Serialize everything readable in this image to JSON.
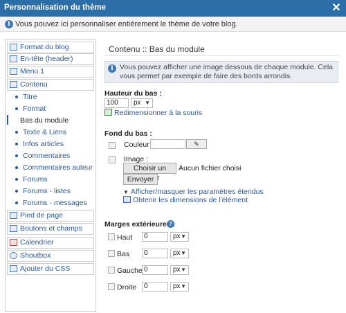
{
  "window": {
    "title": "Personnalisation du thème",
    "close_label": "✕"
  },
  "infobar": {
    "text": "Vous pouvez ici personnaliser entièrement le thème de votre blog."
  },
  "sidebar": {
    "items": [
      {
        "label": "Format du blog"
      },
      {
        "label": "En-tête (header)"
      },
      {
        "label": "Menu 1"
      },
      {
        "label": "Contenu"
      },
      {
        "label": "Pied de page"
      },
      {
        "label": "Boutons et champs"
      },
      {
        "label": "Calendrier"
      },
      {
        "label": "Shoutbox"
      },
      {
        "label": "Ajouter du CSS"
      }
    ],
    "subitems": [
      {
        "label": "Titre"
      },
      {
        "label": "Format"
      },
      {
        "label": "Bas du module"
      },
      {
        "label": "Texte & Liens"
      },
      {
        "label": "Infos articles"
      },
      {
        "label": "Commentaires"
      },
      {
        "label": "Commentaires auteur"
      },
      {
        "label": "Forums"
      },
      {
        "label": "Forums - listes"
      },
      {
        "label": "Forums - messages"
      }
    ]
  },
  "main": {
    "title": "Contenu :: Bas du module",
    "note": "Vous pouvez afficher une image dessous de chaque module. Cela vous permet par exemple de faire des bords arrondis.",
    "height": {
      "title": "Hauteur du bas :",
      "value": "100",
      "unit": "px",
      "resize_link": "Redimensionner à la souris"
    },
    "background": {
      "title": "Fond du bas :",
      "color_label": "Couleur :",
      "color_value": "",
      "image_label": "Image :",
      "choose_file_label": "Choisir un fichier",
      "no_file_label": "Aucun fichier choisi",
      "send_label": "Envoyer",
      "toggle_link": "Afficher/masquer les paramètres étendus",
      "dimensions_link": "Obtenir les dimensions de l'élément"
    },
    "margins": {
      "title": "Marges extérieures :",
      "rows": [
        {
          "label": "Haut",
          "value": "0",
          "unit": "px"
        },
        {
          "label": "Bas",
          "value": "0",
          "unit": "px"
        },
        {
          "label": "Gauche",
          "value": "0",
          "unit": "px"
        },
        {
          "label": "Droite",
          "value": "0",
          "unit": "px"
        }
      ]
    }
  },
  "colors": {
    "titlebar": "#2b6ea8",
    "link": "#2a5a99",
    "note_bg": "#e9edf2"
  }
}
